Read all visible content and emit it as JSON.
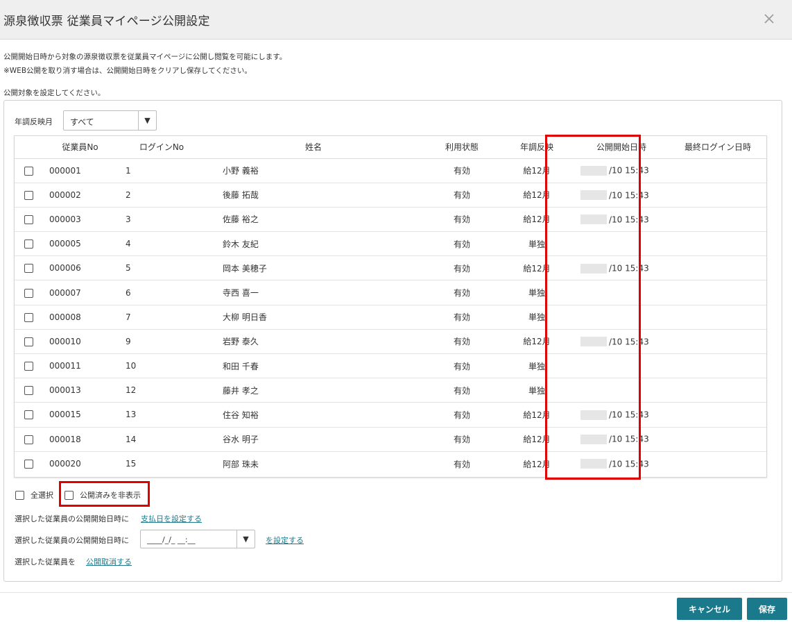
{
  "dialog": {
    "title": "源泉徴収票 従業員マイページ公開設定"
  },
  "description": {
    "line1": "公開開始日時から対象の源泉徴収票を従業員マイページに公開し閲覧を可能にします。",
    "line2": "※WEB公開を取り消す場合は、公開開始日時をクリアし保存してください。",
    "line3": "公開対象を設定してください。"
  },
  "filter": {
    "label": "年調反映月",
    "value": "すべて"
  },
  "table": {
    "headers": [
      "従業員No",
      "ログインNo",
      "姓名",
      "利用状態",
      "年調反映",
      "公開開始日時",
      "最終ログイン日時"
    ],
    "rows": [
      {
        "emp": "000001",
        "login": "1",
        "name": "小野 義裕",
        "status": "有効",
        "nencho": "給12月",
        "pub": "/10 15:43",
        "last": ""
      },
      {
        "emp": "000002",
        "login": "2",
        "name": "後藤 拓哉",
        "status": "有効",
        "nencho": "給12月",
        "pub": "/10 15:43",
        "last": ""
      },
      {
        "emp": "000003",
        "login": "3",
        "name": "佐藤 裕之",
        "status": "有効",
        "nencho": "給12月",
        "pub": "/10 15:43",
        "last": ""
      },
      {
        "emp": "000005",
        "login": "4",
        "name": "鈴木 友紀",
        "status": "有効",
        "nencho": "単独",
        "pub": "",
        "last": ""
      },
      {
        "emp": "000006",
        "login": "5",
        "name": "岡本 美穂子",
        "status": "有効",
        "nencho": "給12月",
        "pub": "/10 15:43",
        "last": ""
      },
      {
        "emp": "000007",
        "login": "6",
        "name": "寺西 喜一",
        "status": "有効",
        "nencho": "単独",
        "pub": "",
        "last": ""
      },
      {
        "emp": "000008",
        "login": "7",
        "name": "大柳 明日香",
        "status": "有効",
        "nencho": "単独",
        "pub": "",
        "last": ""
      },
      {
        "emp": "000010",
        "login": "9",
        "name": "岩野 泰久",
        "status": "有効",
        "nencho": "給12月",
        "pub": "/10 15:43",
        "last": ""
      },
      {
        "emp": "000011",
        "login": "10",
        "name": "和田 千春",
        "status": "有効",
        "nencho": "単独",
        "pub": "",
        "last": ""
      },
      {
        "emp": "000013",
        "login": "12",
        "name": "藤井 孝之",
        "status": "有効",
        "nencho": "単独",
        "pub": "",
        "last": ""
      },
      {
        "emp": "000015",
        "login": "13",
        "name": "住谷 知裕",
        "status": "有効",
        "nencho": "給12月",
        "pub": "/10 15:43",
        "last": ""
      },
      {
        "emp": "000018",
        "login": "14",
        "name": "谷水 明子",
        "status": "有効",
        "nencho": "給12月",
        "pub": "/10 15:43",
        "last": ""
      },
      {
        "emp": "000020",
        "login": "15",
        "name": "阿部 珠未",
        "status": "有効",
        "nencho": "給12月",
        "pub": "/10 15:43",
        "last": ""
      }
    ]
  },
  "options": {
    "select_all": "全選択",
    "hide_published": "公開済みを非表示"
  },
  "actions": {
    "line1_prefix": "選択した従業員の公開開始日時に",
    "line1_link": "支払日を設定する",
    "line2_prefix": "選択した従業員の公開開始日時に",
    "datetime_placeholder": "____/_/_ __:__",
    "line2_link": "を設定する",
    "line3_prefix": "選択した従業員を",
    "line3_link": "公開取消する"
  },
  "footer": {
    "cancel": "キャンセル",
    "save": "保存"
  },
  "colors": {
    "accent": "#1a7a8c",
    "highlight": "#e00000"
  }
}
